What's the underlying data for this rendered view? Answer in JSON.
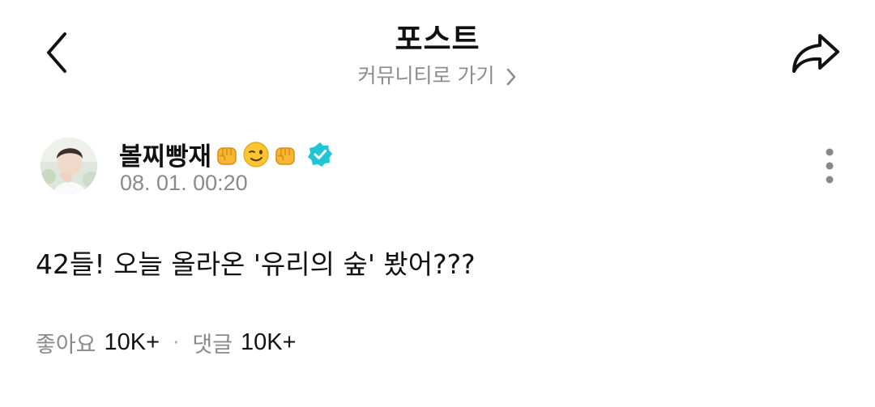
{
  "header": {
    "title": "포스트",
    "community_link": "커뮤니티로 가기",
    "back_icon": "chevron-left-icon",
    "share_icon": "share-arrow-icon"
  },
  "post": {
    "author": {
      "name": "볼찌빵재",
      "emojis": [
        "fist-emoji",
        "wink-emoji",
        "fist-emoji"
      ],
      "verified_icon": "verified-badge-icon",
      "verified_color": "#1ec6d6"
    },
    "time": "08. 01. 00:20",
    "body": "42들! 오늘 올라온 '유리의 숲' 봤어???",
    "more_icon": "more-vertical-icon"
  },
  "stats": {
    "likes_label": "좋아요",
    "likes_value": "10K+",
    "separator": "·",
    "comments_label": "댓글",
    "comments_value": "10K+"
  }
}
